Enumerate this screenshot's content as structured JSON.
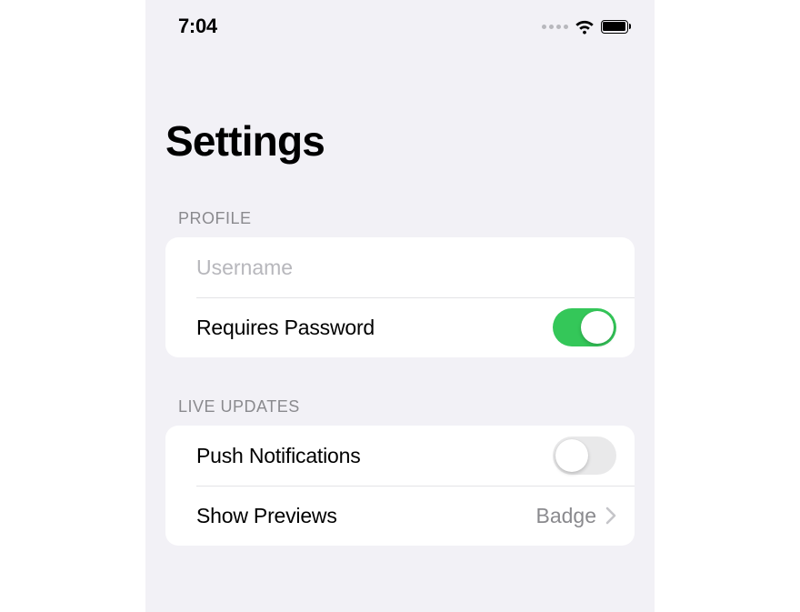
{
  "status_bar": {
    "time": "7:04"
  },
  "page": {
    "title": "Settings"
  },
  "sections": {
    "profile": {
      "header": "PROFILE",
      "username": {
        "placeholder": "Username",
        "value": ""
      },
      "requires_password": {
        "label": "Requires Password",
        "on": true
      }
    },
    "live_updates": {
      "header": "LIVE UPDATES",
      "push_notifications": {
        "label": "Push Notifications",
        "on": false
      },
      "show_previews": {
        "label": "Show Previews",
        "value": "Badge"
      }
    }
  }
}
